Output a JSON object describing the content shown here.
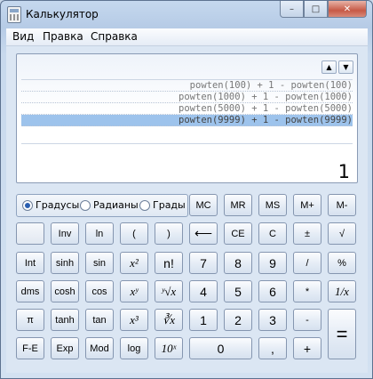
{
  "window": {
    "title": "Калькулятор",
    "controls": [
      "–",
      "□",
      "✕"
    ]
  },
  "menu": [
    "Вид",
    "Правка",
    "Справка"
  ],
  "history": [
    "powten(100) + 1 - powten(100)",
    "powten(1000) + 1 - powten(1000)",
    "powten(5000) + 1 - powten(5000)",
    "powten(9999) + 1 - powten(9999)"
  ],
  "history_selected_index": 3,
  "result": "1",
  "angle_modes": [
    {
      "label": "Градусы",
      "checked": true
    },
    {
      "label": "Радианы",
      "checked": false
    },
    {
      "label": "Грады",
      "checked": false
    }
  ],
  "memory_buttons": [
    "MC",
    "MR",
    "MS",
    "M+",
    "M-"
  ],
  "rows": [
    [
      "",
      "Inv",
      "ln",
      "(",
      ")",
      "⟵",
      "CE",
      "C",
      "±",
      "√"
    ],
    [
      "Int",
      "sinh",
      "sin",
      "x²",
      "n!",
      "7",
      "8",
      "9",
      "/",
      "%"
    ],
    [
      "dms",
      "cosh",
      "cos",
      "xʸ",
      "ʸ√x",
      "4",
      "5",
      "6",
      "*",
      "1/x"
    ],
    [
      "π",
      "tanh",
      "tan",
      "x³",
      "∛x",
      "1",
      "2",
      "3",
      "-",
      "="
    ],
    [
      "F-E",
      "Exp",
      "Mod",
      "log",
      "10ˣ",
      "0",
      ",",
      "+"
    ]
  ]
}
